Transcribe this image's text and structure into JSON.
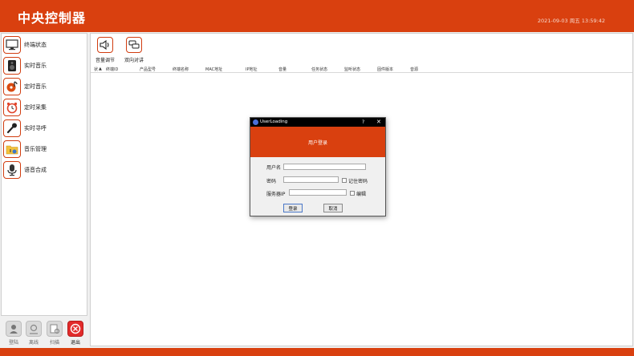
{
  "header": {
    "title": "中央控制器",
    "datetime": "2021-09-03 周五 13:59:42"
  },
  "sidebar": {
    "items": [
      {
        "label": "终端状态",
        "icon": "monitor-icon"
      },
      {
        "label": "实时音乐",
        "icon": "speaker-icon"
      },
      {
        "label": "定时音乐",
        "icon": "music-disc-icon"
      },
      {
        "label": "定时采集",
        "icon": "alarm-clock-icon"
      },
      {
        "label": "实时寻呼",
        "icon": "microphone-icon"
      },
      {
        "label": "音乐管理",
        "icon": "music-folder-icon"
      },
      {
        "label": "语音合成",
        "icon": "voice-mic-icon"
      }
    ]
  },
  "bottom_actions": [
    {
      "label": "登陆",
      "icon": "login-icon"
    },
    {
      "label": "离线",
      "icon": "offline-icon"
    },
    {
      "label": "扫描",
      "icon": "scan-icon"
    },
    {
      "label": "退出",
      "icon": "exit-icon"
    }
  ],
  "toolbar": {
    "volume_label": "音量调节",
    "intercom_label": "双向对讲"
  },
  "table": {
    "columns": [
      "状",
      "终端ID",
      "产品型号",
      "终端名称",
      "MAC地址",
      "IP地址",
      "音量",
      "任务状态",
      "监听状态",
      "固件版本",
      "音源"
    ],
    "rows": []
  },
  "dialog": {
    "title": "UserLoading",
    "help": "?",
    "close": "✕",
    "banner": "用户登录",
    "username_label": "用户名",
    "username_value": "",
    "password_label": "密码",
    "password_value": "",
    "remember_label": "记住密码",
    "remember_checked": false,
    "server_label": "服务器IP",
    "server_value": "",
    "edit_label": "编辑",
    "edit_checked": false,
    "login_button": "登录",
    "cancel_button": "取消"
  },
  "colors": {
    "accent": "#d9400f",
    "exit": "#e22b2b"
  }
}
